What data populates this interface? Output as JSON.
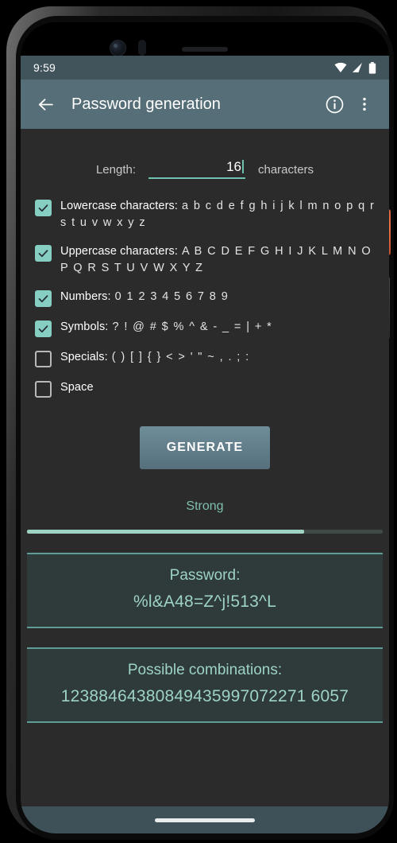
{
  "status_bar": {
    "time": "9:59",
    "icons": [
      "wifi-icon",
      "cellular-signal-icon",
      "battery-icon"
    ]
  },
  "app_bar": {
    "back_icon": "arrow-back-icon",
    "title": "Password generation",
    "info_icon": "info-circle-icon",
    "overflow_icon": "more-vertical-icon"
  },
  "length": {
    "label": "Length:",
    "value": "16",
    "unit": "characters",
    "accent": "#6fbfae"
  },
  "options": [
    {
      "name": "Lowercase characters:",
      "chars": "a b c d e f g h i j k l m n o p q r s t u v w x y z",
      "checked": true
    },
    {
      "name": "Uppercase characters:",
      "chars": "A B C D E F G H I J K L M N O P Q R S T U V W X Y Z",
      "checked": true
    },
    {
      "name": "Numbers:",
      "chars": "0 1 2 3 4 5 6 7 8 9",
      "checked": true
    },
    {
      "name": "Symbols:",
      "chars": "? ! @ # $ % ^ & - _ = | + *",
      "checked": true
    },
    {
      "name": "Specials:",
      "chars": "( ) [ ] { } < > ' \" ~ , . ; :",
      "checked": false
    },
    {
      "name": "Space",
      "chars": "",
      "checked": false
    }
  ],
  "generate": {
    "label": "GENERATE"
  },
  "strength": {
    "label": "Strong",
    "percent": 78,
    "fill_color": "#9fd3c3",
    "track_color": "#3f4a46",
    "text_color": "#7fbfae"
  },
  "password_card": {
    "title": "Password:",
    "value": "%l&A48=Z^j!513^L"
  },
  "combinations_card": {
    "title": "Possible combinations:",
    "value": "12388464380849435997072271 6057"
  },
  "nav_bar": {
    "gesture_pill": "home-gesture-pill"
  }
}
